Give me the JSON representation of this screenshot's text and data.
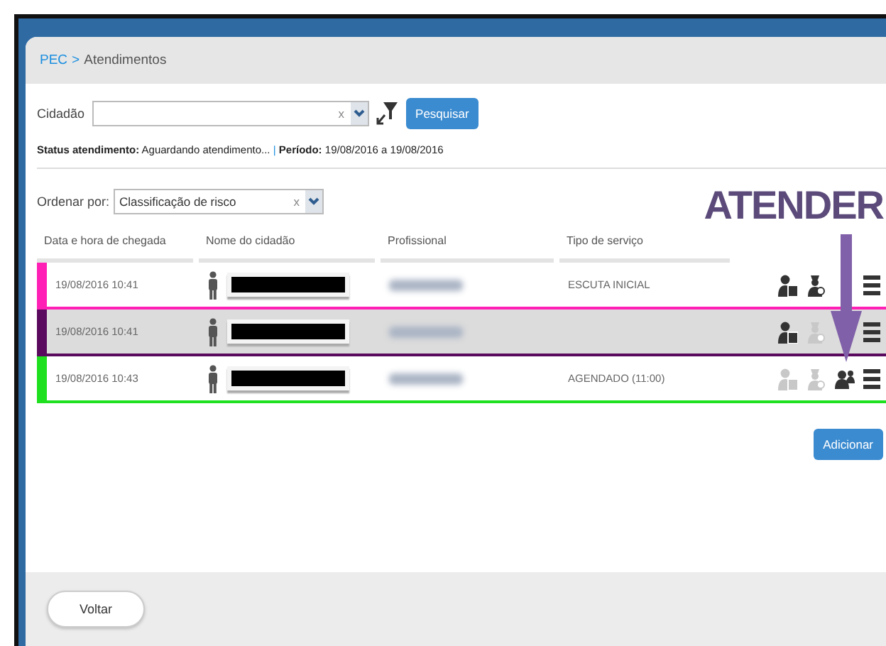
{
  "breadcrumb": {
    "root": "PEC",
    "separator": ">",
    "current": "Atendimentos"
  },
  "filter": {
    "label": "Cidadão",
    "clear": "x",
    "search_button": "Pesquisar"
  },
  "status": {
    "status_label": "Status atendimento:",
    "status_value": "Aguardando atendimento...",
    "divider": "|",
    "period_label": "Período:",
    "period_value": "19/08/2016 a 19/08/2016"
  },
  "annotation": {
    "text": "ATENDER"
  },
  "sort": {
    "label": "Ordenar por:",
    "value": "Classificação de risco",
    "clear": "x"
  },
  "table": {
    "columns": [
      "Data e hora de chegada",
      "Nome do cidadão",
      "Profissional",
      "Tipo de serviço"
    ],
    "rows": [
      {
        "arrival": "19/08/2016 10:41",
        "service": "ESCUTA INICIAL",
        "color": "#ff1fb4",
        "selected": false,
        "actions": [
          {
            "kind": "triage",
            "disabled": false
          },
          {
            "kind": "doctor",
            "disabled": false
          }
        ]
      },
      {
        "arrival": "19/08/2016 10:41",
        "service": "",
        "color": "#5a0a5e",
        "selected": true,
        "actions": [
          {
            "kind": "triage",
            "disabled": false
          },
          {
            "kind": "doctor",
            "disabled": true
          }
        ]
      },
      {
        "arrival": "19/08/2016 10:43",
        "service": "AGENDADO (11:00)",
        "color": "#1ee01e",
        "selected": false,
        "actions": [
          {
            "kind": "triage",
            "disabled": true
          },
          {
            "kind": "doctor",
            "disabled": true
          },
          {
            "kind": "group",
            "disabled": false
          }
        ]
      }
    ]
  },
  "add_button": "Adicionar",
  "back_button": "Voltar"
}
